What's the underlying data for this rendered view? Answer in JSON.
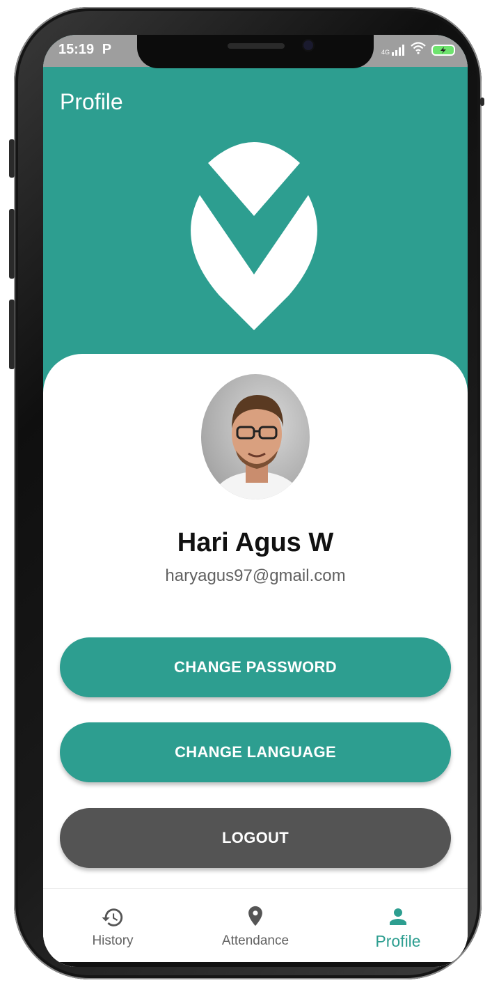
{
  "status_bar": {
    "time": "15:19",
    "app_icon": "P",
    "network": "4G"
  },
  "app_bar": {
    "title": "Profile"
  },
  "user": {
    "name": "Hari Agus W",
    "email": "haryagus97@gmail.com"
  },
  "actions": {
    "change_password": "CHANGE PASSWORD",
    "change_language": "CHANGE LANGUAGE",
    "logout": "LOGOUT"
  },
  "bottom_nav": {
    "items": [
      {
        "label": "History",
        "icon": "history-icon"
      },
      {
        "label": "Attendance",
        "icon": "location-pin-icon"
      },
      {
        "label": "Profile",
        "icon": "person-icon",
        "active": true
      }
    ]
  },
  "colors": {
    "primary": "#2d9e90",
    "logout": "#545454",
    "email_text": "#616161",
    "status_bar": "#9e9e9e"
  }
}
